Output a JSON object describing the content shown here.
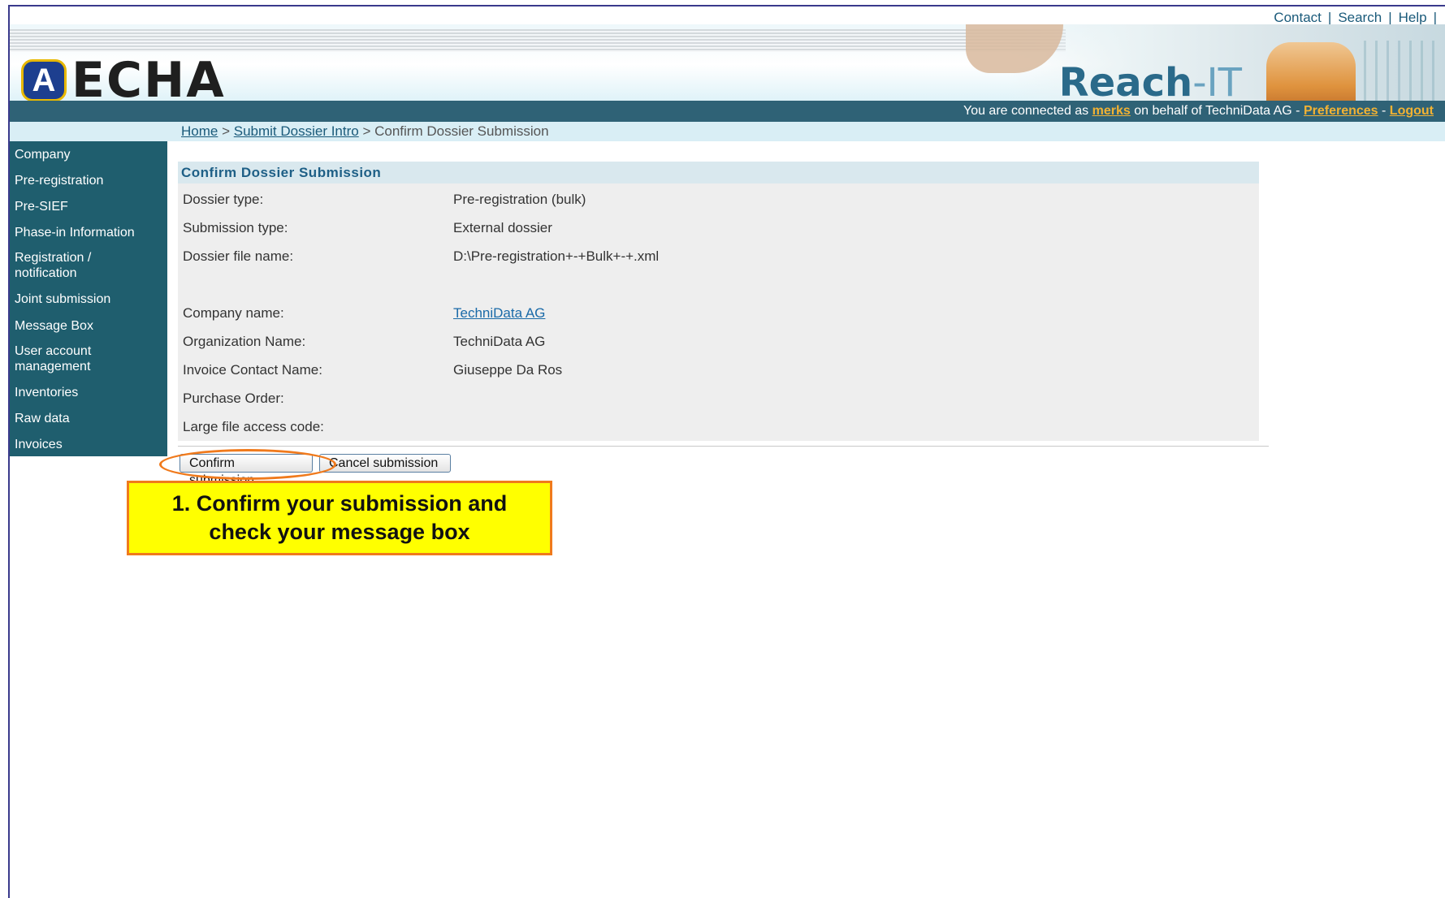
{
  "top_links": [
    "Contact",
    "Search",
    "Help"
  ],
  "header": {
    "logo_text": "ECHA",
    "logo_emblem": "A",
    "product_name_1": "Reach",
    "product_name_2": "-IT"
  },
  "status_bar": {
    "prefix": "You are connected as ",
    "user": "merks",
    "middle": " on behalf of TechniData AG - ",
    "preferences": "Preferences",
    "sep": " - ",
    "logout": "Logout"
  },
  "breadcrumb": {
    "home": "Home",
    "sep1": " > ",
    "submit_intro": "Submit Dossier Intro",
    "sep2": " > Confirm Dossier Submission"
  },
  "sidebar": {
    "items": [
      "Company",
      "Pre-registration",
      "Pre-SIEF",
      "Phase-in Information",
      "Registration /\nnotification",
      "Joint submission",
      "Message Box",
      "User account\nmanagement",
      "Inventories",
      "Raw data",
      "Invoices"
    ]
  },
  "panel": {
    "title": "Confirm Dossier Submission",
    "rows": [
      {
        "label": "Dossier type:",
        "value": "Pre-registration (bulk)"
      },
      {
        "label": "Submission type:",
        "value": "External dossier"
      },
      {
        "label": "Dossier file name:",
        "value": "D:\\Pre-registration+-+Bulk+-+.xml"
      },
      {
        "label": "Company name:",
        "value": "TechniData AG"
      },
      {
        "label": "Organization Name:",
        "value": "TechniData AG"
      },
      {
        "label": "Invoice Contact Name:",
        "value": "Giuseppe Da Ros"
      },
      {
        "label": "Purchase Order:",
        "value": ""
      },
      {
        "label": "Large file access code:",
        "value": ""
      }
    ]
  },
  "buttons": {
    "confirm": "Confirm submission",
    "cancel": "Cancel submission"
  },
  "callout": {
    "text": "1. Confirm your submission and\ncheck your message box"
  },
  "colors": {
    "sidebar_bg": "#1f5e6e",
    "status_bar_bg": "#2f6276",
    "callout_bg": "#ffff00",
    "callout_border": "#f07a1c",
    "link": "#1a5a7a",
    "status_highlight": "#f2b233"
  }
}
